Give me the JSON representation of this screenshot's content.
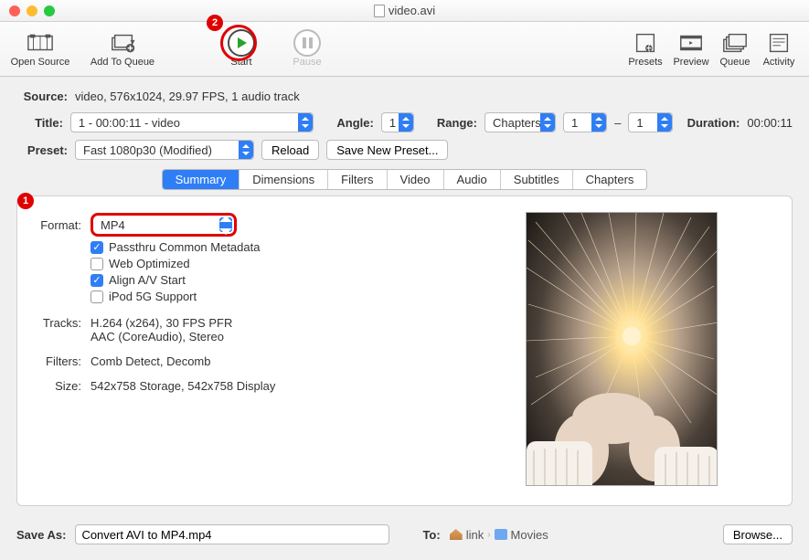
{
  "window": {
    "title": "video.avi"
  },
  "toolbar": {
    "open_source": "Open Source",
    "add_to_queue": "Add To Queue",
    "start": "Start",
    "pause": "Pause",
    "presets": "Presets",
    "preview": "Preview",
    "queue": "Queue",
    "activity": "Activity"
  },
  "source": {
    "label": "Source:",
    "value": "video, 576x1024, 29.97 FPS, 1 audio track"
  },
  "title": {
    "label": "Title:",
    "value": "1 - 00:00:11 - video"
  },
  "angle": {
    "label": "Angle:",
    "value": "1"
  },
  "range": {
    "label": "Range:",
    "value": "Chapters",
    "from": "1",
    "to": "1",
    "dash": "–"
  },
  "duration": {
    "label": "Duration:",
    "value": "00:00:11"
  },
  "preset": {
    "label": "Preset:",
    "value": "Fast 1080p30 (Modified)",
    "reload": "Reload",
    "save_new": "Save New Preset..."
  },
  "tabs": {
    "summary": "Summary",
    "dimensions": "Dimensions",
    "filters": "Filters",
    "video": "Video",
    "audio": "Audio",
    "subtitles": "Subtitles",
    "chapters": "Chapters"
  },
  "summary": {
    "format_label": "Format:",
    "format_value": "MP4",
    "passthru": "Passthru Common Metadata",
    "weboptimized": "Web Optimized",
    "alignav": "Align A/V Start",
    "ipod": "iPod 5G Support",
    "tracks_label": "Tracks:",
    "tracks_value1": "H.264 (x264), 30 FPS PFR",
    "tracks_value2": "AAC (CoreAudio), Stereo",
    "filters_label": "Filters:",
    "filters_value": "Comb Detect, Decomb",
    "size_label": "Size:",
    "size_value": "542x758 Storage, 542x758 Display"
  },
  "footer": {
    "saveas_label": "Save As:",
    "saveas_value": "Convert AVI to MP4.mp4",
    "to_label": "To:",
    "path1": "link",
    "path2": "Movies",
    "browse": "Browse..."
  },
  "badges": {
    "one": "1",
    "two": "2"
  }
}
